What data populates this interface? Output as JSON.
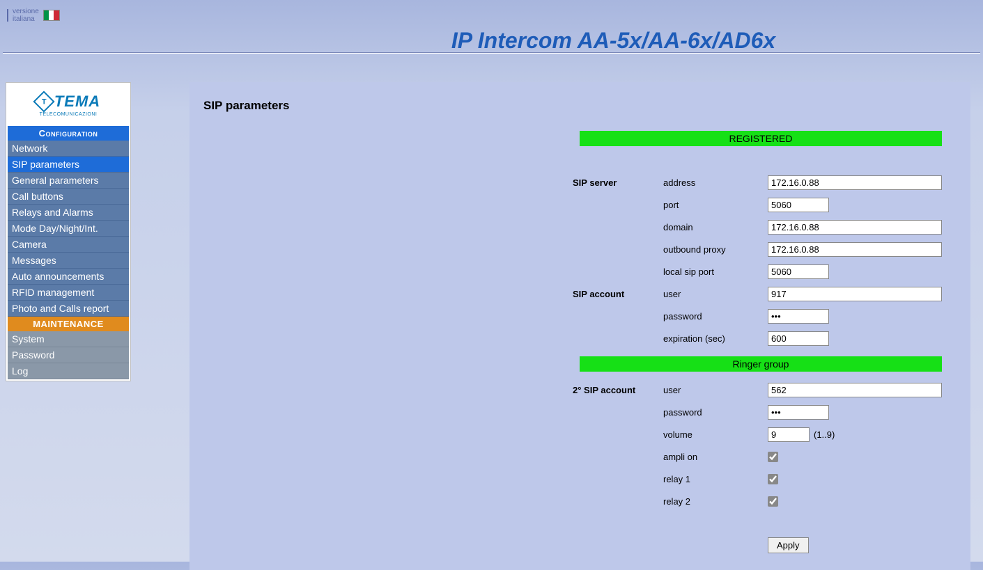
{
  "lang": {
    "label_line1": "versione",
    "label_line2": "italiana"
  },
  "header": {
    "title": "IP Intercom AA-5x/AA-6x/AD6x"
  },
  "logo": {
    "brand": "TEMA",
    "sub": "TELECOMUNICAZIONI"
  },
  "sidebar": {
    "config_header": "Configuration",
    "items": [
      {
        "label": "Network"
      },
      {
        "label": "SIP parameters"
      },
      {
        "label": "General parameters"
      },
      {
        "label": "Call buttons"
      },
      {
        "label": "Relays and Alarms"
      },
      {
        "label": "Mode Day/Night/Int."
      },
      {
        "label": "Camera"
      },
      {
        "label": "Messages"
      },
      {
        "label": "Auto announcements"
      },
      {
        "label": "RFID management"
      },
      {
        "label": "Photo and Calls report"
      }
    ],
    "maint_header": "MAINTENANCE",
    "maint_items": [
      {
        "label": "System"
      },
      {
        "label": "Password"
      },
      {
        "label": "Log"
      }
    ]
  },
  "page": {
    "title": "SIP parameters",
    "status_banner": "REGISTERED",
    "section_sip_server": "SIP server",
    "section_sip_account": "SIP account",
    "section_second_account": "2° SIP account",
    "ringer_banner": "Ringer group",
    "labels": {
      "address": "address",
      "port": "port",
      "domain": "domain",
      "outbound_proxy": "outbound proxy",
      "local_sip_port": "local sip port",
      "user": "user",
      "password": "password",
      "expiration": "expiration (sec)",
      "volume": "volume",
      "volume_hint": "(1..9)",
      "ampli_on": "ampli on",
      "relay1": "relay 1",
      "relay2": "relay 2"
    },
    "values": {
      "address": "172.16.0.88",
      "port": "5060",
      "domain": "172.16.0.88",
      "outbound_proxy": "172.16.0.88",
      "local_sip_port": "5060",
      "user": "917",
      "password": "•••",
      "expiration": "600",
      "user2": "562",
      "password2": "•••",
      "volume": "9",
      "ampli_on": true,
      "relay1": true,
      "relay2": true
    },
    "apply": "Apply"
  }
}
